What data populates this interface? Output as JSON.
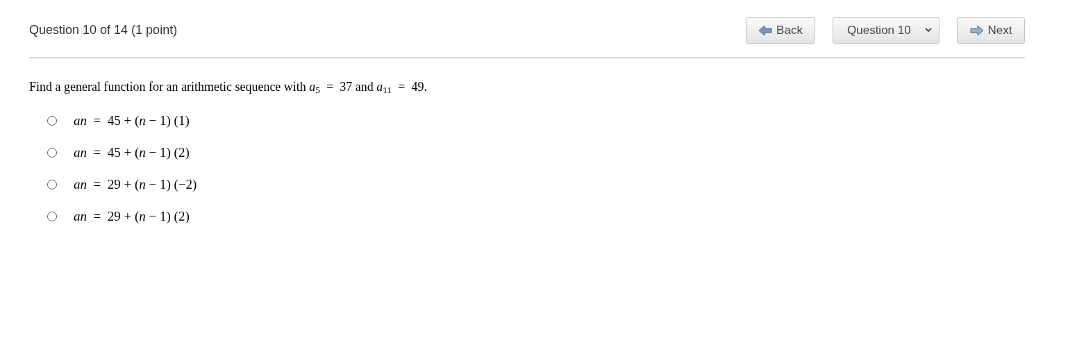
{
  "header": {
    "title": "Question 10 of 14 (1 point)",
    "back_button": "Back",
    "question_select": "Question 10",
    "next_button": "Next"
  },
  "question": "Find a general function for an arithmetic sequence with *a*$_{5}$  =  37 and *a*$_{11}$  =  49.",
  "options": [
    {
      "text": "*an*  =  45 + (*n* − 1) (1)",
      "selected": false
    },
    {
      "text": "*an*  =  45 + (*n* − 1) (2)",
      "selected": false
    },
    {
      "text": "*an*  =  29 + (*n* − 1) (−2)",
      "selected": false
    },
    {
      "text": "*an*  =  29 + (*n* − 1) (2)",
      "selected": false
    }
  ]
}
